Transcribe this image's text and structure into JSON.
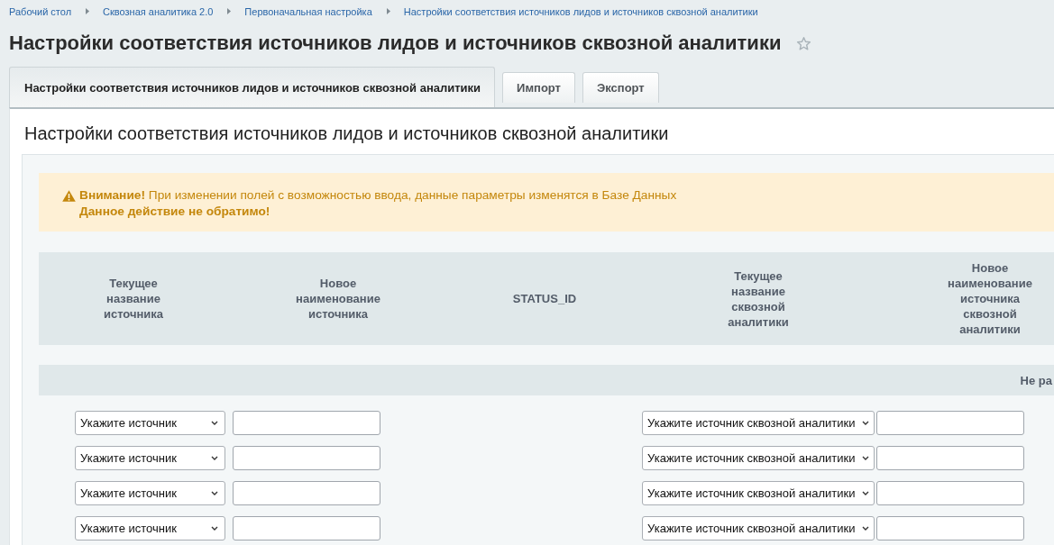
{
  "breadcrumbs": [
    "Рабочий стол",
    "Сквозная аналитика 2.0",
    "Первоначальная настройка",
    "Настройки соответствия источников лидов и источников сквозной аналитики"
  ],
  "page_title": "Настройки соответствия источников лидов и источников сквозной аналитики",
  "starred": false,
  "tabs": [
    {
      "label": "Настройки соответствия источников лидов и источников сквозной аналитики",
      "selected": true
    },
    {
      "label": "Импорт",
      "selected": false
    },
    {
      "label": "Экспорт",
      "selected": false
    }
  ],
  "section_title": "Настройки соответствия источников лидов и источников сквозной аналитики",
  "alert": {
    "message": "**Внимание!** При изменении полей с возможностью ввода, данные параметры изменятся в Базе Данных",
    "note": "Данное действие не обратимо!"
  },
  "table": {
    "columns": [
      "Текущее название источника",
      "Новое наименование источника",
      "STATUS_ID",
      "Текущее название сквозной аналитики",
      "Новое наименование источника сквозной аналитики"
    ],
    "group_row": "Не ра",
    "rows": [
      {
        "source": "Укажите источник",
        "analytics_source": "Укажите источник сквозной аналитики"
      },
      {
        "source": "Укажите источник",
        "analytics_source": "Укажите источник сквозной аналитики"
      },
      {
        "source": "Укажите источник",
        "analytics_source": "Укажите источник сквозной аналитики"
      },
      {
        "source": "Укажите источник",
        "analytics_source": "Укажите источник сквозной аналитики"
      }
    ]
  }
}
